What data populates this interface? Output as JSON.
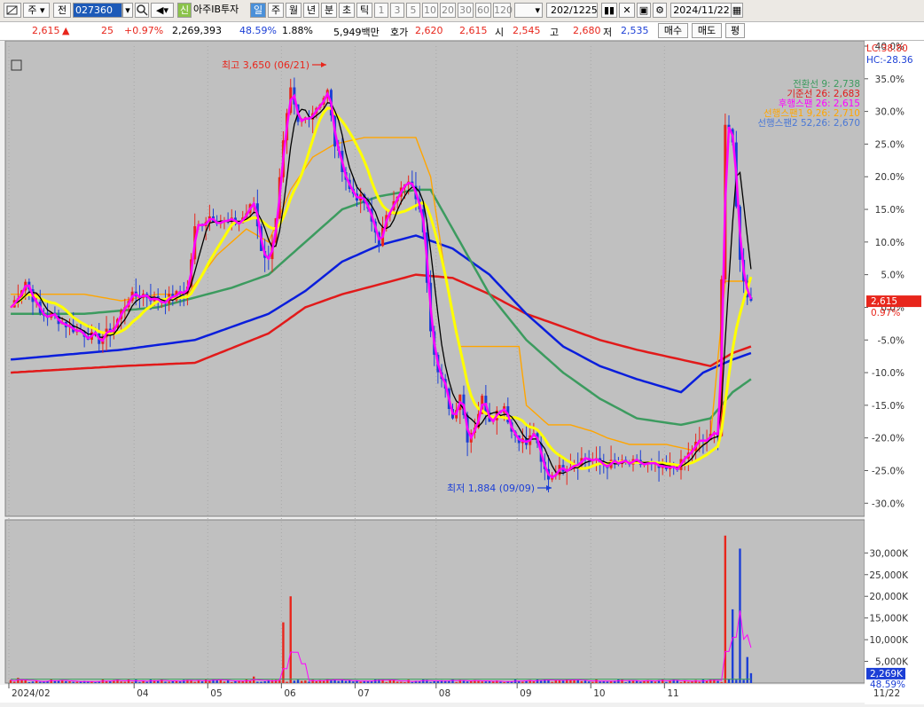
{
  "toolbar": {
    "icon1": "chart-mode-icon",
    "market_label": "주",
    "all_label": "전",
    "code": "027360",
    "stock_name": "아주IB투자",
    "credit_badge": "신",
    "period_buttons": [
      "일",
      "주",
      "월",
      "년",
      "분",
      "초",
      "틱"
    ],
    "number_buttons": [
      "1",
      "3",
      "5",
      "10",
      "20",
      "30",
      "60",
      "120"
    ],
    "count": "202",
    "total": "/1225",
    "date": "2024/11/22"
  },
  "info": {
    "price": "2,615",
    "arrow": "▲",
    "change": "25",
    "change_pct": "+0.97%",
    "volume": "2,269,393",
    "vol_ratio": "48.59%",
    "turnover_rate": "1.88%",
    "amount": "5,949백만",
    "quote_label": "호가",
    "ask": "2,620",
    "bid": "2,615",
    "open_label": "시",
    "open": "2,545",
    "high_label": "고",
    "high": "2,680",
    "low_label": "저",
    "low": "2,535",
    "buy_btn": "매수",
    "sell_btn": "매도",
    "eval_btn": "평"
  },
  "colors": {
    "bg": "#c0c0c0",
    "up": "#e8261c",
    "down": "#1c3fd6",
    "tenkan": "#000000",
    "kijun": "#ffff00",
    "lagging": "#ff00ff",
    "span1": "#ffa500",
    "span2": "#3c9b5f",
    "ma_blue": "#0a1edc",
    "ma_red": "#e11a1a"
  },
  "chart_data": {
    "type": "line",
    "title": "",
    "price_axis": {
      "unit": "%",
      "ticks": [
        "40.0%",
        "35.0%",
        "30.0%",
        "25.0%",
        "20.0%",
        "15.0%",
        "10.0%",
        "5.0%",
        "0.0%",
        "-5.0%",
        "-10.0%",
        "-15.0%",
        "-20.0%",
        "-25.0%",
        "-30.0%"
      ],
      "current_pct_label": "0.97%",
      "current_price_label": "2,615",
      "lc": "LC:38.80",
      "hc": "HC:-28.36"
    },
    "volume_axis": {
      "ticks": [
        "30,000K",
        "25,000K",
        "20,000K",
        "15,000K",
        "10,000K",
        "5,000K"
      ],
      "current_label": "2,269K",
      "ratio_label": "48.59%"
    },
    "x_labels": [
      "2024/02",
      "04",
      "05",
      "06",
      "07",
      "08",
      "09",
      "10",
      "11"
    ],
    "x_right_label": "11/22",
    "annotations": {
      "high": "최고 3,650 (06/21)",
      "low": "최저 1,884 (09/09)"
    },
    "legend": [
      {
        "name": "전환선 9: 2,738",
        "color": "#3c9b5f"
      },
      {
        "name": "기준선 26: 2,683",
        "color": "#e11a1a"
      },
      {
        "name": "후행스팬 26: 2,615",
        "color": "#ff00ff"
      },
      {
        "name": "선행스팬1 9,26: 2,710",
        "color": "#ffa500"
      },
      {
        "name": "선행스팬2 52,26: 2,670",
        "color": "#4a78d6"
      }
    ],
    "n_bars": 202,
    "price_anchors": [
      [
        0,
        0
      ],
      [
        4,
        4
      ],
      [
        8,
        -1
      ],
      [
        12,
        -1.5
      ],
      [
        16,
        -3
      ],
      [
        20,
        -4
      ],
      [
        24,
        -5
      ],
      [
        28,
        -3
      ],
      [
        32,
        1.5
      ],
      [
        36,
        2
      ],
      [
        40,
        1
      ],
      [
        44,
        1.5
      ],
      [
        48,
        3
      ],
      [
        50,
        12
      ],
      [
        54,
        14
      ],
      [
        58,
        13
      ],
      [
        62,
        13
      ],
      [
        66,
        16
      ],
      [
        68,
        9
      ],
      [
        70,
        7
      ],
      [
        72,
        14
      ],
      [
        74,
        25
      ],
      [
        76,
        33
      ],
      [
        78,
        28
      ],
      [
        82,
        30
      ],
      [
        86,
        33
      ],
      [
        88,
        25
      ],
      [
        92,
        18
      ],
      [
        96,
        16
      ],
      [
        100,
        10
      ],
      [
        104,
        17
      ],
      [
        108,
        19
      ],
      [
        110,
        17
      ],
      [
        112,
        12
      ],
      [
        114,
        -3
      ],
      [
        116,
        -10
      ],
      [
        118,
        -13
      ],
      [
        120,
        -17
      ],
      [
        122,
        -13
      ],
      [
        124,
        -20
      ],
      [
        126,
        -18
      ],
      [
        128,
        -14
      ],
      [
        130,
        -17
      ],
      [
        132,
        -16
      ],
      [
        134,
        -15
      ],
      [
        136,
        -19
      ],
      [
        140,
        -21
      ],
      [
        142,
        -19
      ],
      [
        144,
        -24
      ],
      [
        146,
        -26
      ],
      [
        148,
        -25
      ],
      [
        152,
        -24
      ],
      [
        156,
        -23
      ],
      [
        160,
        -24
      ],
      [
        166,
        -24
      ],
      [
        172,
        -24
      ],
      [
        178,
        -25
      ],
      [
        182,
        -24
      ],
      [
        186,
        -21
      ],
      [
        190,
        -20
      ],
      [
        192,
        -19
      ],
      [
        194,
        28
      ],
      [
        196,
        25
      ],
      [
        198,
        7
      ],
      [
        200,
        2
      ],
      [
        201,
        0.97
      ]
    ],
    "ma_blue_anchors": [
      [
        0,
        -8
      ],
      [
        30,
        -6.5
      ],
      [
        50,
        -5
      ],
      [
        70,
        -1
      ],
      [
        80,
        2.5
      ],
      [
        90,
        7
      ],
      [
        100,
        9.5
      ],
      [
        110,
        11
      ],
      [
        120,
        9
      ],
      [
        130,
        5
      ],
      [
        140,
        -1
      ],
      [
        150,
        -6
      ],
      [
        160,
        -9
      ],
      [
        170,
        -11
      ],
      [
        182,
        -13
      ],
      [
        188,
        -10
      ],
      [
        196,
        -8
      ],
      [
        201,
        -7
      ]
    ],
    "ma_red_anchors": [
      [
        0,
        -10
      ],
      [
        30,
        -9
      ],
      [
        50,
        -8.5
      ],
      [
        70,
        -4
      ],
      [
        80,
        0
      ],
      [
        90,
        2
      ],
      [
        100,
        3.5
      ],
      [
        110,
        5
      ],
      [
        120,
        4.5
      ],
      [
        130,
        2
      ],
      [
        140,
        -1
      ],
      [
        150,
        -3
      ],
      [
        160,
        -5
      ],
      [
        170,
        -6.5
      ],
      [
        182,
        -8
      ],
      [
        190,
        -9
      ],
      [
        196,
        -7
      ],
      [
        201,
        -6
      ]
    ],
    "span2_anchors": [
      [
        0,
        -1
      ],
      [
        20,
        -1
      ],
      [
        40,
        0
      ],
      [
        60,
        3
      ],
      [
        70,
        5
      ],
      [
        80,
        10
      ],
      [
        90,
        15
      ],
      [
        100,
        17
      ],
      [
        110,
        18
      ],
      [
        114,
        18
      ],
      [
        118,
        14
      ],
      [
        124,
        8
      ],
      [
        130,
        2
      ],
      [
        140,
        -5
      ],
      [
        150,
        -10
      ],
      [
        160,
        -14
      ],
      [
        170,
        -17
      ],
      [
        182,
        -18
      ],
      [
        190,
        -17
      ],
      [
        196,
        -13
      ],
      [
        201,
        -11
      ]
    ],
    "span1_anchors": [
      [
        0,
        2
      ],
      [
        20,
        2
      ],
      [
        30,
        1
      ],
      [
        40,
        2
      ],
      [
        48,
        2
      ],
      [
        56,
        8
      ],
      [
        64,
        12
      ],
      [
        70,
        10
      ],
      [
        76,
        18
      ],
      [
        82,
        23
      ],
      [
        88,
        25
      ],
      [
        96,
        26
      ],
      [
        104,
        26
      ],
      [
        110,
        26
      ],
      [
        114,
        20
      ],
      [
        118,
        5
      ],
      [
        122,
        -6
      ],
      [
        126,
        -6
      ],
      [
        132,
        -6
      ],
      [
        138,
        -6
      ],
      [
        140,
        -15
      ],
      [
        146,
        -18
      ],
      [
        152,
        -18
      ],
      [
        158,
        -19
      ],
      [
        162,
        -20
      ],
      [
        168,
        -21
      ],
      [
        178,
        -21
      ],
      [
        186,
        -22
      ],
      [
        190,
        -20
      ],
      [
        194,
        4
      ],
      [
        201,
        4
      ]
    ],
    "volume_values": [
      [
        2,
        1200
      ],
      [
        10,
        500
      ],
      [
        22,
        400
      ],
      [
        38,
        800
      ],
      [
        46,
        500
      ],
      [
        66,
        1500
      ],
      [
        74,
        14000
      ],
      [
        76,
        20000
      ],
      [
        86,
        1000
      ],
      [
        100,
        800
      ],
      [
        120,
        900
      ],
      [
        132,
        600
      ],
      [
        150,
        700
      ],
      [
        170,
        600
      ],
      [
        188,
        800
      ],
      [
        194,
        34000
      ],
      [
        196,
        17000
      ],
      [
        198,
        31000
      ],
      [
        200,
        6000
      ],
      [
        201,
        2269
      ]
    ]
  }
}
